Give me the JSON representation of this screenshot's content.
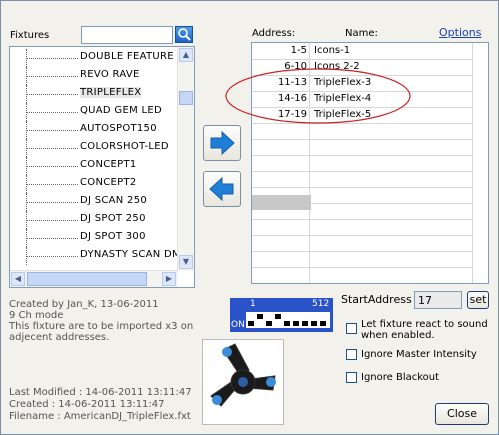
{
  "fixtures_label": "Fixtures",
  "fixture_items": [
    "DOUBLE FEATURE",
    "REVO RAVE",
    "TRIPLEFLEX",
    "QUAD GEM LED",
    "AUTOSPOT150",
    "COLORSHOT-LED",
    "CONCEPT1",
    "CONCEPT2",
    "DJ SCAN 250",
    "DJ SPOT 250",
    "DJ SPOT 300",
    "DYNASTY SCAN DMX"
  ],
  "selected_fixture": "TRIPLEFLEX",
  "address_header": "Address:",
  "name_header": "Name:",
  "options_link": "Options",
  "rows": [
    {
      "address": "1-5",
      "name": "Icons-1"
    },
    {
      "address": "6-10",
      "name": "Icons 2-2"
    },
    {
      "address": "11-13",
      "name": "TripleFlex-3"
    },
    {
      "address": "14-16",
      "name": "TripleFlex-4"
    },
    {
      "address": "17-19",
      "name": "TripleFlex-5"
    }
  ],
  "description": {
    "line1": "Created by Jan_K, 13-06-2011",
    "line2": "9 Ch mode",
    "line3": "This fixture are to be imported x3 on",
    "line4": "adjecent addresses."
  },
  "dip": {
    "left": "1",
    "right": "512",
    "on": "ON"
  },
  "start_address_label": "StartAddress :",
  "start_address_value": "17",
  "set_button": "set",
  "options": {
    "sound": "Let fixture react to sound when enabled.",
    "master": "Ignore Master Intensity",
    "blackout": "Ignore Blackout"
  },
  "file_info": {
    "modified": "Last Modified : 14-06-2011 13:11:47",
    "created": "Created : 14-06-2011 13:11:47",
    "filename": "Filename : AmericanDJ_TripleFlex.fxt"
  },
  "close_button": "Close",
  "colors": {
    "accent": "#1f3c7a",
    "arrow": "#1e7ed8",
    "highlight_ellipse": "#cc1f1f",
    "dip_blue": "#2a52c9"
  }
}
